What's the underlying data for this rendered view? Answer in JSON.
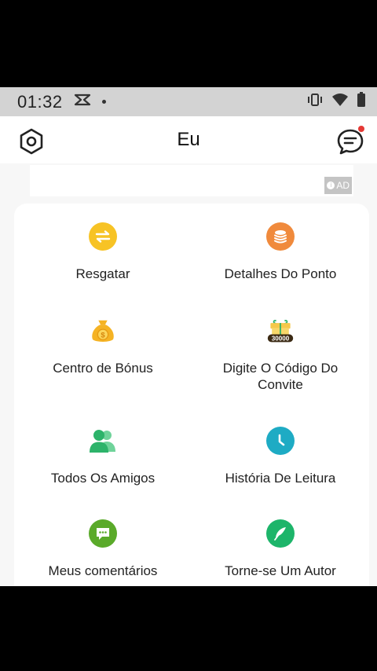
{
  "status_bar": {
    "time": "01:32"
  },
  "header": {
    "title": "Eu"
  },
  "ad": {
    "badge_label": "AD"
  },
  "menu": {
    "items": [
      {
        "label": "Resgatar",
        "icon": "exchange-icon",
        "color": "#f7c325"
      },
      {
        "label": "Detalhes Do Ponto",
        "icon": "coins-stack-icon",
        "color": "#f08a3c"
      },
      {
        "label": "Centro de Bónus",
        "icon": "money-bag-icon",
        "color": "#f5b324"
      },
      {
        "label": "Digite O Código Do Convite",
        "icon": "gift-30000-icon",
        "color": "#f5c84a"
      },
      {
        "label": "Todos Os Amigos",
        "icon": "friends-icon",
        "color": "#2db36a"
      },
      {
        "label": "História De Leitura",
        "icon": "clock-icon",
        "color": "#1eabc4"
      },
      {
        "label": "Meus comentários",
        "icon": "comment-icon",
        "color": "#5aaa2a"
      },
      {
        "label": "Torne-se Um Autor",
        "icon": "quill-icon",
        "color": "#1db56a"
      }
    ],
    "gift_badge_text": "30000"
  }
}
